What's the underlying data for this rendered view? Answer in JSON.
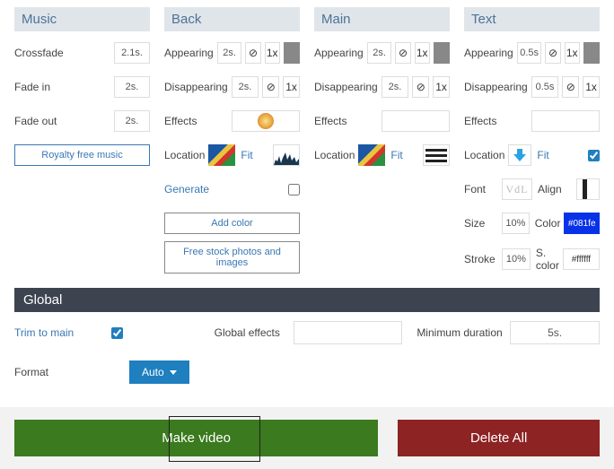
{
  "music": {
    "title": "Music",
    "crossfade_label": "Crossfade",
    "crossfade_val": "2.1s.",
    "fadein_label": "Fade in",
    "fadein_val": "2s.",
    "fadeout_label": "Fade out",
    "fadeout_val": "2s.",
    "royalty_btn": "Royalty free music"
  },
  "back": {
    "title": "Back",
    "appearing_label": "Appearing",
    "appearing_val": "2s.",
    "appearing_mult": "1x",
    "disappearing_label": "Disappearing",
    "disappearing_val": "2s.",
    "disappearing_mult": "1x",
    "effects_label": "Effects",
    "location_label": "Location",
    "location_fit": "Fit",
    "generate_label": "Generate",
    "addcolor_btn": "Add color",
    "stock_btn": "Free stock photos and images"
  },
  "main": {
    "title": "Main",
    "appearing_label": "Appearing",
    "appearing_val": "2s.",
    "appearing_mult": "1x",
    "disappearing_label": "Disappearing",
    "disappearing_val": "2s.",
    "disappearing_mult": "1x",
    "effects_label": "Effects",
    "location_label": "Location",
    "location_fit": "Fit"
  },
  "text": {
    "title": "Text",
    "appearing_label": "Appearing",
    "appearing_val": "0.5s",
    "appearing_mult": "1x",
    "disappearing_label": "Disappearing",
    "disappearing_val": "0.5s",
    "disappearing_mult": "1x",
    "effects_label": "Effects",
    "location_label": "Location",
    "location_fit": "Fit",
    "font_label": "Font",
    "align_label": "Align",
    "size_label": "Size",
    "size_val": "10%",
    "color_label": "Color",
    "color_val": "#081fe",
    "stroke_label": "Stroke",
    "stroke_val": "10%",
    "scolor_label": "S. color",
    "scolor_val": "#ffffff"
  },
  "global": {
    "title": "Global",
    "trim_label": "Trim to main",
    "effects_label": "Global effects",
    "mindur_label": "Minimum duration",
    "mindur_val": "5s.",
    "format_label": "Format",
    "format_val": "Auto"
  },
  "footer": {
    "make": "Make video",
    "delete": "Delete All"
  }
}
